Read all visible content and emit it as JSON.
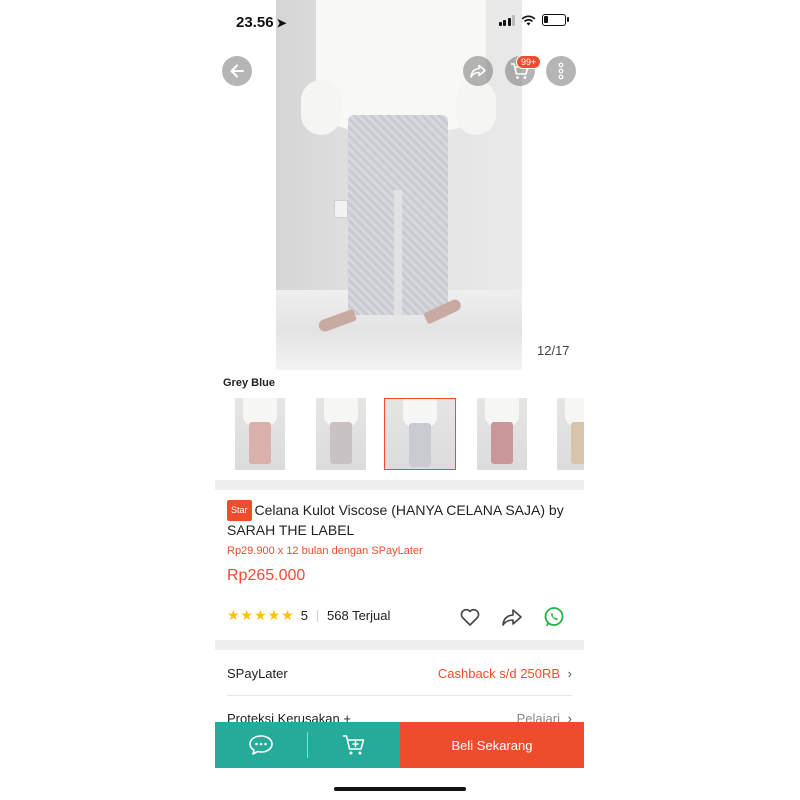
{
  "status_bar": {
    "time": "23.56",
    "location_glyph": "➤"
  },
  "header": {
    "cart_badge": "99+"
  },
  "gallery": {
    "counter": "12/17"
  },
  "variant": {
    "title": "Grey Blue",
    "thumbs": [
      {
        "top": "#f6f6f4",
        "pants": "#d9b1aa"
      },
      {
        "top": "#f6f6f4",
        "pants": "#c8c2c4"
      },
      {
        "top": "#f6f6f4",
        "pants": "#c9cbd1"
      },
      {
        "top": "#f6f6f4",
        "pants": "#c9979a"
      },
      {
        "top": "#f6f6f4",
        "pants": "#d9c4ab"
      }
    ]
  },
  "product": {
    "badge": "Star",
    "title": "Celana Kulot Viscose (HANYA CELANA SAJA) by SARAH THE LABEL",
    "installment": "Rp29.900 x 12 bulan dengan SPayLater",
    "price": "Rp265.000",
    "stars": "★★★★★",
    "rating": "5",
    "sold": "568 Terjual"
  },
  "rows": {
    "spaylater_label": "SPayLater",
    "spaylater_value": "Cashback s/d 250RB",
    "protection_label": "Proteksi Kerusakan +",
    "protection_value": "Pelajari",
    "chevron": "›"
  },
  "bottom_bar": {
    "buy_label": "Beli Sekarang"
  },
  "colors": {
    "accent": "#ee4d2d",
    "teal": "#26aa99",
    "star": "#ffc107"
  }
}
